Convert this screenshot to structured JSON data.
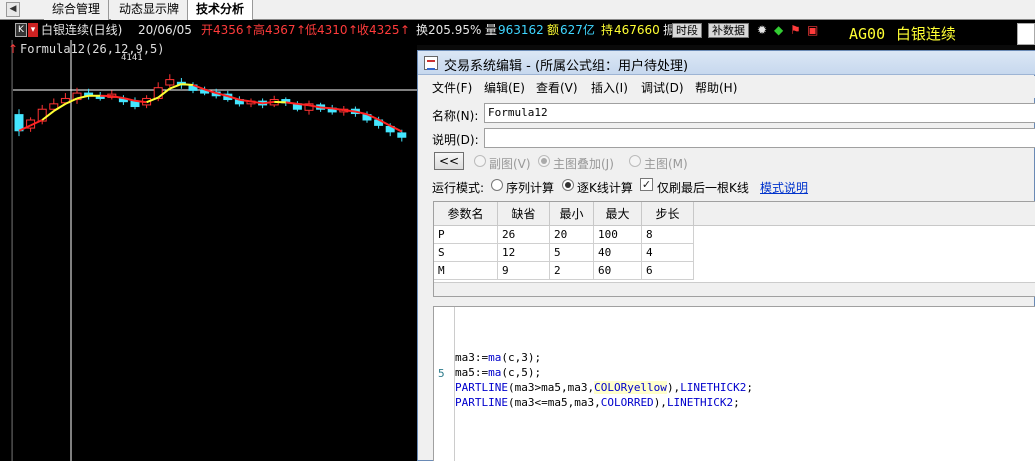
{
  "tabs": [
    {
      "label": "综合管理"
    },
    {
      "label": "动态显示牌"
    },
    {
      "label": "技术分析"
    }
  ],
  "quote": {
    "k_tag": "K",
    "title": "白银连续(日线)",
    "date": "20/06/05",
    "open": "开4356",
    "high": "高4367",
    "low": "低4310",
    "close": "收4325",
    "turnover": "换205.95%",
    "volume_label": "量",
    "volume": "963162",
    "amount_label": "额",
    "amount": "627亿",
    "oi_label": "持",
    "oi": "467660",
    "trunc": "振",
    "btn_period": "时段",
    "btn_data": "补数据",
    "symbol": "AG00",
    "name": "白银连续"
  },
  "chart": {
    "formula_label": "Formula12(26,12,9,5)",
    "peak_label": "4141"
  },
  "dialog": {
    "title": "交易系统编辑 - (所属公式组：用户待处理)",
    "menu": [
      "文件(F)",
      "编辑(E)",
      "查看(V)",
      "插入(I)",
      "调试(D)",
      "帮助(H)"
    ],
    "name_label": "名称(N):",
    "name_value": "Formula12",
    "desc_label": "说明(D):",
    "desc_value": "",
    "collapse_button": "<<",
    "chart_mode_sub": "副图(V)",
    "chart_mode_overlay": "主图叠加(J)",
    "chart_mode_main": "主图(M)",
    "run_mode_label": "运行模式:",
    "run_mode_seq": "序列计算",
    "run_mode_kline": "逐K线计算",
    "refresh_last": "仅刷最后一根K线",
    "mode_help_link": "模式说明",
    "param_headers": [
      "参数名",
      "缺省",
      "最小",
      "最大",
      "步长"
    ],
    "params": [
      [
        "P",
        "26",
        "20",
        "100",
        "8"
      ],
      [
        "S",
        "12",
        "5",
        "40",
        "4"
      ],
      [
        "M",
        "9",
        "2",
        "60",
        "6"
      ]
    ],
    "line_no": "5",
    "code_lines": [
      [
        "ma3:=",
        "ma",
        "(c,3);"
      ],
      [
        "ma5:=",
        "ma",
        "(c,5);"
      ],
      [
        "PARTLINE",
        "(ma3>ma5,ma3,",
        "COLORyellow",
        "),",
        "LINETHICK2",
        ";"
      ],
      [
        "PARTLINE",
        "(ma3<=ma5,ma3,",
        "COLORRED",
        "),",
        "LINETHICK2",
        ";"
      ]
    ]
  },
  "chart_candles": [
    {
      "open": 4140,
      "close": 4110,
      "high": 4150,
      "low": 4100
    },
    {
      "open": 4115,
      "close": 4130,
      "high": 4135,
      "low": 4108
    },
    {
      "open": 4128,
      "close": 4150,
      "high": 4158,
      "low": 4122
    },
    {
      "open": 4150,
      "close": 4160,
      "high": 4170,
      "low": 4145
    },
    {
      "open": 4162,
      "close": 4170,
      "high": 4180,
      "low": 4158
    },
    {
      "open": 4168,
      "close": 4180,
      "high": 4190,
      "low": 4160
    },
    {
      "open": 4180,
      "close": 4175,
      "high": 4188,
      "low": 4168
    },
    {
      "open": 4175,
      "close": 4170,
      "high": 4182,
      "low": 4166
    },
    {
      "open": 4172,
      "close": 4178,
      "high": 4185,
      "low": 4168
    },
    {
      "open": 4170,
      "close": 4164,
      "high": 4176,
      "low": 4158
    },
    {
      "open": 4165,
      "close": 4155,
      "high": 4172,
      "low": 4150
    },
    {
      "open": 4158,
      "close": 4170,
      "high": 4176,
      "low": 4152
    },
    {
      "open": 4170,
      "close": 4190,
      "high": 4200,
      "low": 4165
    },
    {
      "open": 4195,
      "close": 4205,
      "high": 4215,
      "low": 4190
    },
    {
      "open": 4200,
      "close": 4195,
      "high": 4208,
      "low": 4188
    },
    {
      "open": 4195,
      "close": 4185,
      "high": 4200,
      "low": 4180
    },
    {
      "open": 4186,
      "close": 4180,
      "high": 4192,
      "low": 4176
    },
    {
      "open": 4182,
      "close": 4175,
      "high": 4188,
      "low": 4170
    },
    {
      "open": 4178,
      "close": 4168,
      "high": 4184,
      "low": 4164
    },
    {
      "open": 4168,
      "close": 4160,
      "high": 4174,
      "low": 4155
    },
    {
      "open": 4160,
      "close": 4165,
      "high": 4170,
      "low": 4154
    },
    {
      "open": 4165,
      "close": 4158,
      "high": 4170,
      "low": 4152
    },
    {
      "open": 4158,
      "close": 4168,
      "high": 4175,
      "low": 4154
    },
    {
      "open": 4168,
      "close": 4162,
      "high": 4172,
      "low": 4156
    },
    {
      "open": 4160,
      "close": 4150,
      "high": 4165,
      "low": 4146
    },
    {
      "open": 4148,
      "close": 4160,
      "high": 4166,
      "low": 4140
    },
    {
      "open": 4158,
      "close": 4150,
      "high": 4162,
      "low": 4145
    },
    {
      "open": 4152,
      "close": 4145,
      "high": 4158,
      "low": 4140
    },
    {
      "open": 4145,
      "close": 4150,
      "high": 4156,
      "low": 4138
    },
    {
      "open": 4150,
      "close": 4142,
      "high": 4155,
      "low": 4136
    },
    {
      "open": 4140,
      "close": 4130,
      "high": 4146,
      "low": 4125
    },
    {
      "open": 4130,
      "close": 4120,
      "high": 4136,
      "low": 4114
    },
    {
      "open": 4118,
      "close": 4108,
      "high": 4124,
      "low": 4100
    },
    {
      "open": 4106,
      "close": 4098,
      "high": 4112,
      "low": 4090
    }
  ]
}
